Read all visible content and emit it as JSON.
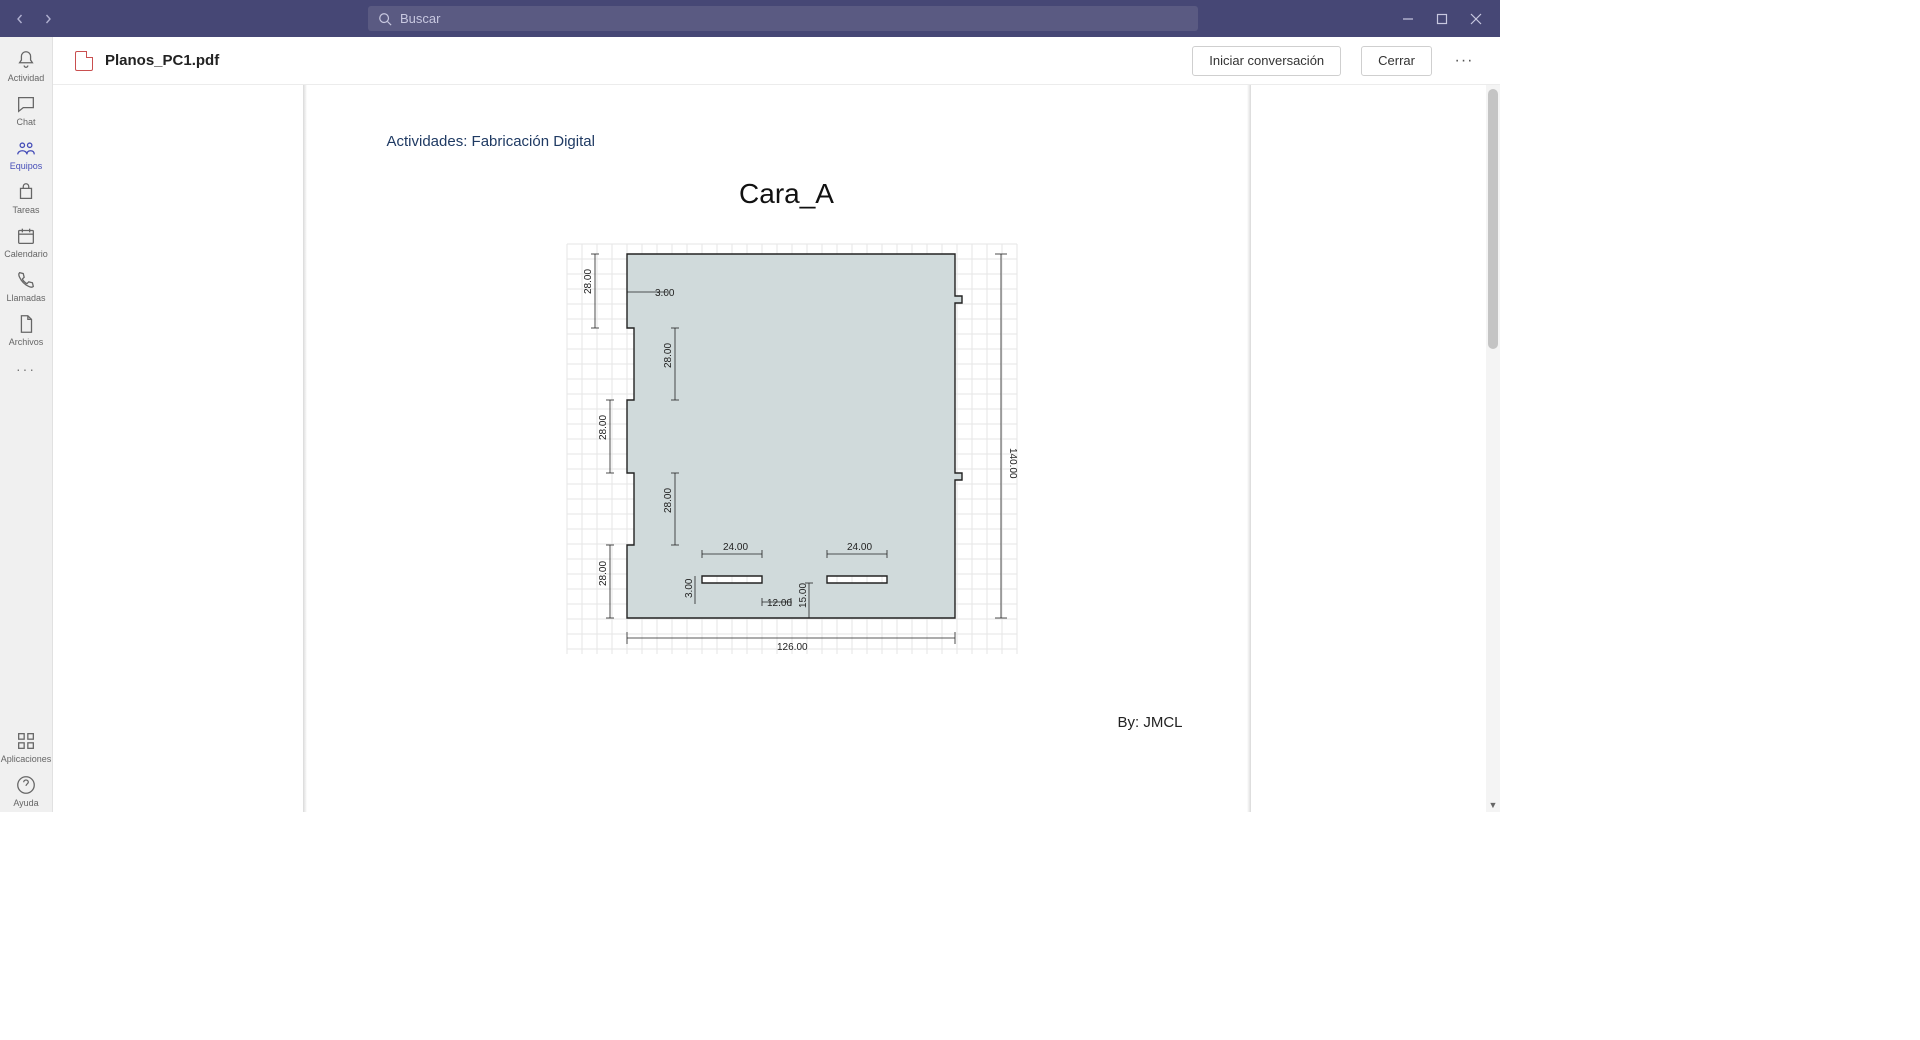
{
  "titlebar": {
    "search_placeholder": "Buscar"
  },
  "rail": {
    "actividad": "Actividad",
    "chat": "Chat",
    "equipos": "Equipos",
    "tareas": "Tareas",
    "calendario": "Calendario",
    "llamadas": "Llamadas",
    "archivos": "Archivos",
    "aplicaciones": "Aplicaciones",
    "ayuda": "Ayuda"
  },
  "doc": {
    "filename": "Planos_PC1.pdf",
    "start_conversation": "Iniciar conversación",
    "close": "Cerrar"
  },
  "page": {
    "heading": "Actividades: Fabricación Digital",
    "drawing_title": "Cara_A",
    "byline": "By: JMCL"
  },
  "dims": {
    "d28_a": "28.00",
    "d28_b": "28.00",
    "d28_c": "28.00",
    "d28_d": "28.00",
    "d28_e": "28.00",
    "d3": "3.00",
    "d3_b": "3.00",
    "d24_a": "24.00",
    "d24_b": "24.00",
    "d12": "12.00",
    "d15": "15.00",
    "d126": "126.00",
    "d140": "140.00"
  }
}
